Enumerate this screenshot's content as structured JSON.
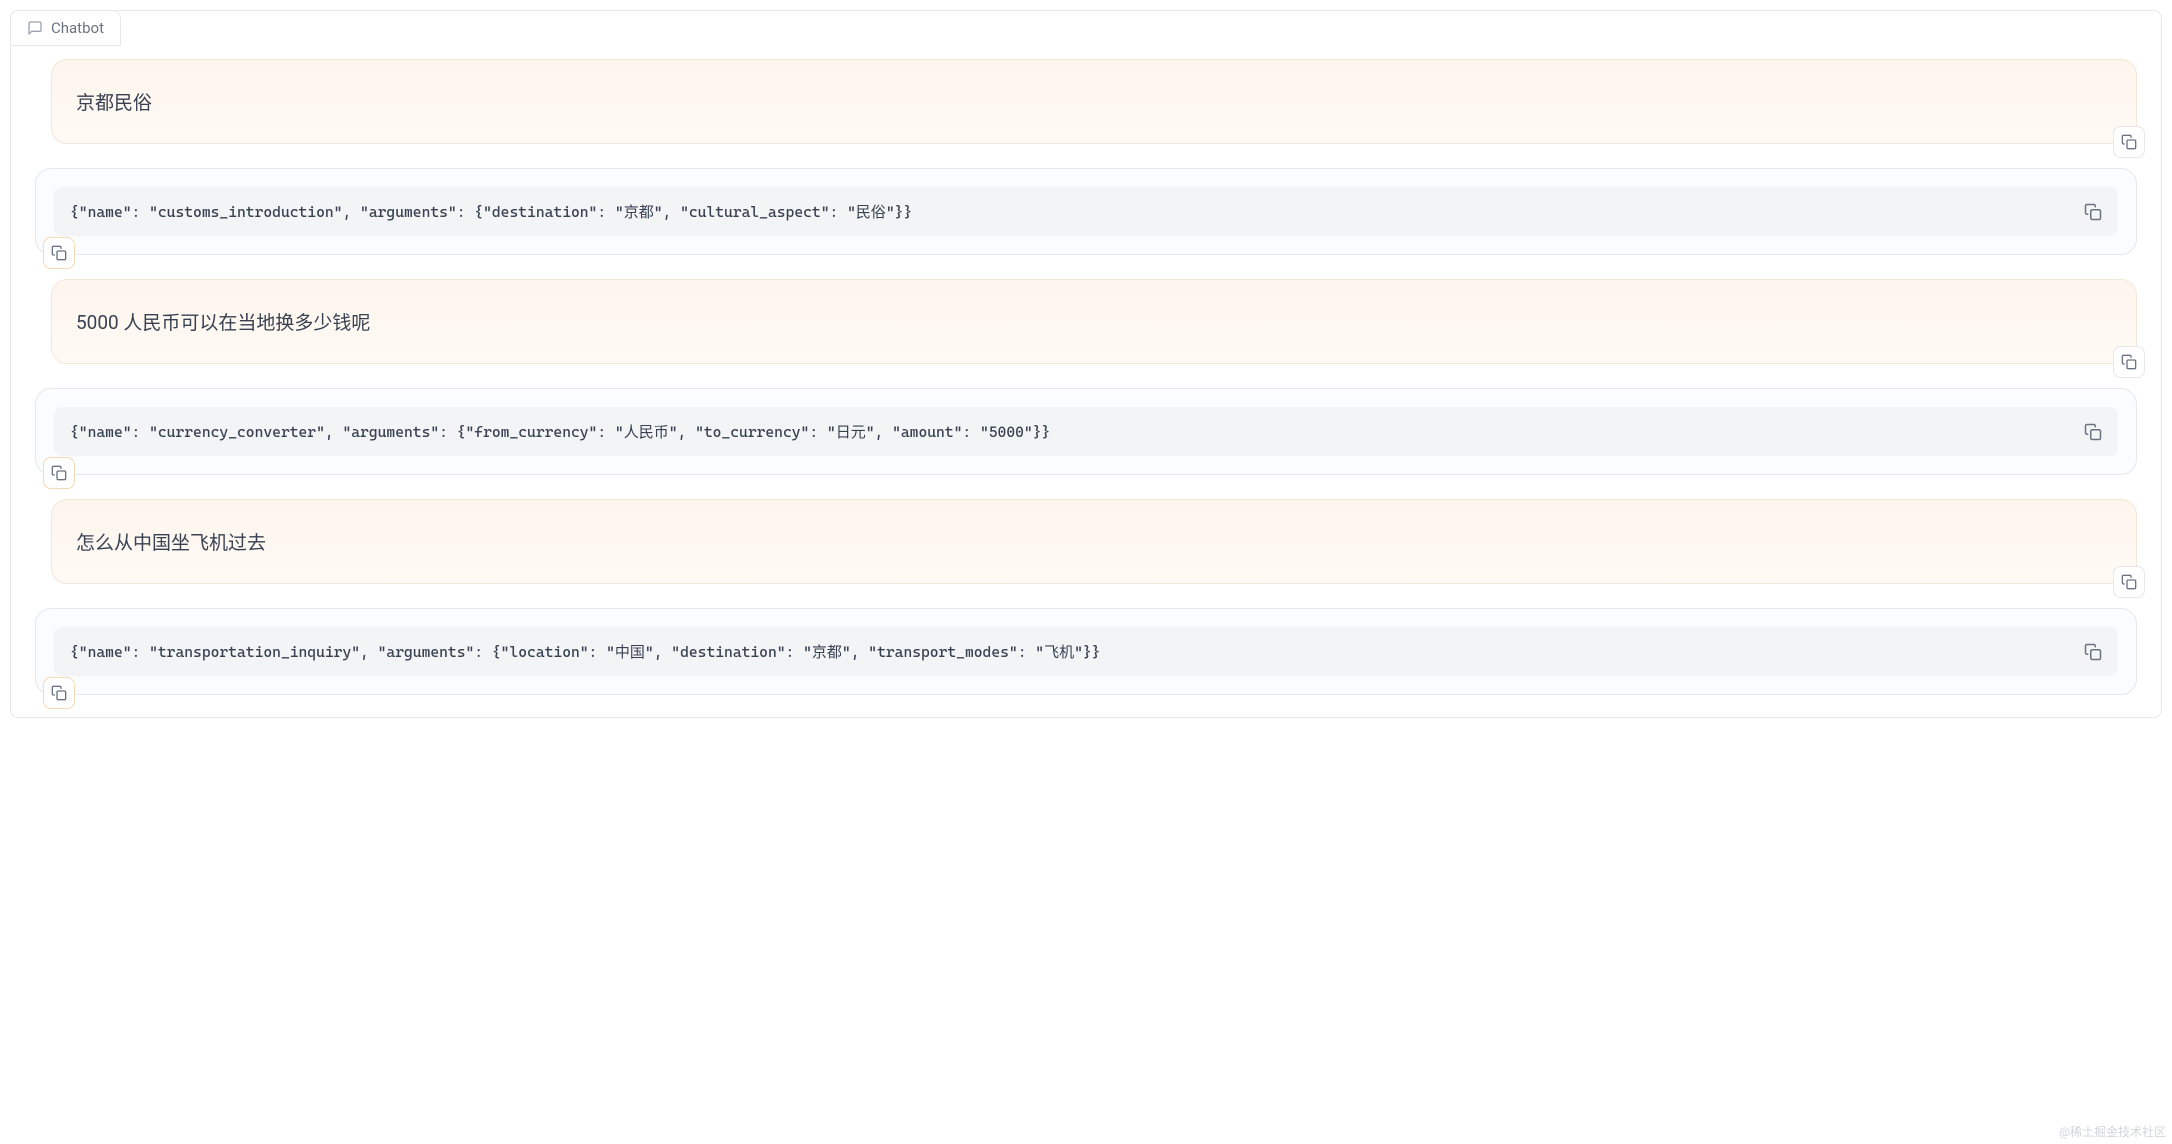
{
  "tab": {
    "label": "Chatbot"
  },
  "messages": [
    {
      "role": "user",
      "text": "京都民俗"
    },
    {
      "role": "bot",
      "code": "{\"name\": \"customs_introduction\", \"arguments\": {\"destination\": \"京都\", \"cultural_aspect\": \"民俗\"}}"
    },
    {
      "role": "user",
      "text": "5000 人民币可以在当地换多少钱呢"
    },
    {
      "role": "bot",
      "code": "{\"name\": \"currency_converter\", \"arguments\": {\"from_currency\": \"人民币\", \"to_currency\": \"日元\", \"amount\": \"5000\"}}"
    },
    {
      "role": "user",
      "text": "怎么从中国坐飞机过去"
    },
    {
      "role": "bot",
      "code": "{\"name\": \"transportation_inquiry\", \"arguments\": {\"location\": \"中国\", \"destination\": \"京都\", \"transport_modes\": \"飞机\"}}"
    }
  ],
  "watermark": "@稀土掘金技术社区"
}
